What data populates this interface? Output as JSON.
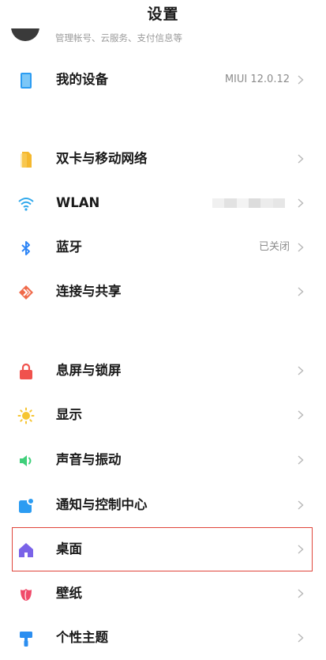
{
  "header": {
    "title": "设置"
  },
  "account": {
    "subtitle": "管理帐号、云服务、支付信息等"
  },
  "device": {
    "label": "我的设备",
    "value": "MIUI 12.0.12",
    "icon": "phone-icon"
  },
  "network": [
    {
      "label": "双卡与移动网络",
      "icon": "sim-card-icon"
    },
    {
      "label": "WLAN",
      "icon": "wifi-icon",
      "value_redacted": true
    },
    {
      "label": "蓝牙",
      "value": "已关闭",
      "icon": "bluetooth-icon"
    },
    {
      "label": "连接与共享",
      "icon": "share-icon"
    }
  ],
  "personalization": [
    {
      "label": "息屏与锁屏",
      "icon": "lock-icon"
    },
    {
      "label": "显示",
      "icon": "sun-icon"
    },
    {
      "label": "声音与振动",
      "icon": "speaker-icon"
    },
    {
      "label": "通知与控制中心",
      "icon": "notification-icon"
    },
    {
      "label": "桌面",
      "icon": "home-icon",
      "highlighted": true
    },
    {
      "label": "壁纸",
      "icon": "flower-icon"
    },
    {
      "label": "个性主题",
      "icon": "brush-icon"
    }
  ],
  "colors": {
    "highlight_border": "#e0453b",
    "sim": "#f5b82e",
    "wifi": "#2fa8ec",
    "bluetooth": "#2f86f6",
    "share": "#f06a4a",
    "lock": "#f0524d",
    "display": "#f6c531",
    "sound": "#3fcf7a",
    "notification": "#2b9cf2",
    "home": "#7a63e8",
    "wallpaper": "#f04a6a",
    "theme": "#2b8ef0"
  }
}
